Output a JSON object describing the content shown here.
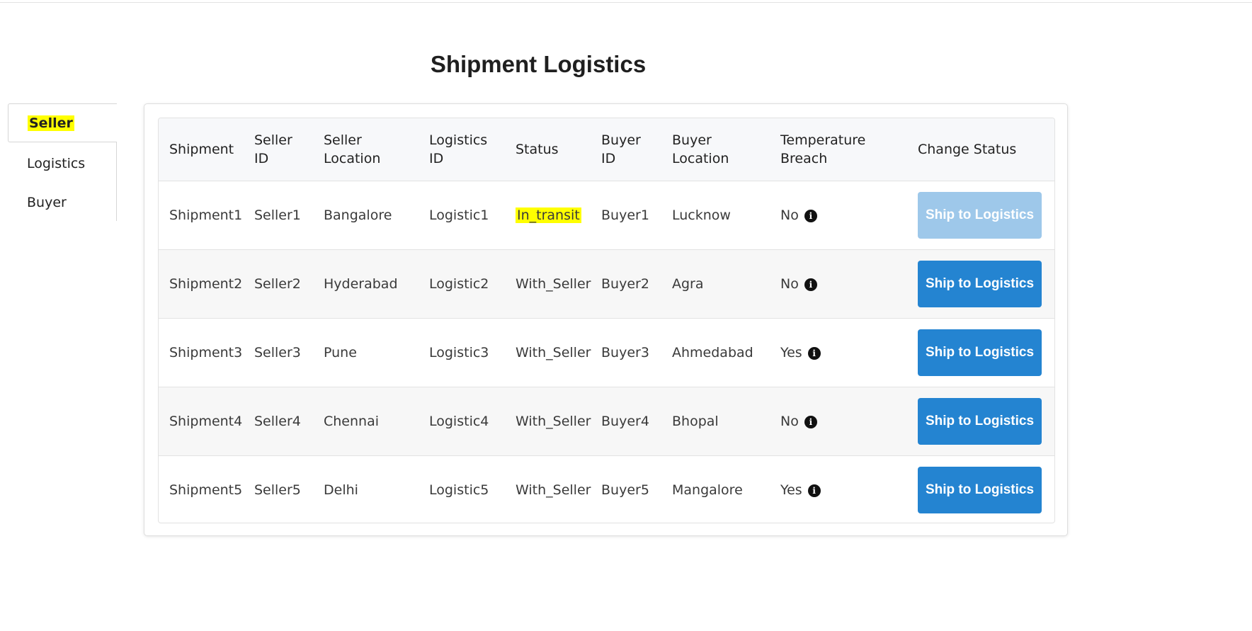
{
  "page": {
    "title": "Shipment Logistics"
  },
  "tabs": [
    {
      "label": "Seller",
      "active": true
    },
    {
      "label": "Logistics",
      "active": false
    },
    {
      "label": "Buyer",
      "active": false
    }
  ],
  "table": {
    "headers": [
      [
        "Shipment"
      ],
      [
        "Seller",
        "ID"
      ],
      [
        "Seller",
        "Location"
      ],
      [
        "Logistics",
        "ID"
      ],
      [
        "Status"
      ],
      [
        "Buyer",
        "ID"
      ],
      [
        "Buyer",
        "Location"
      ],
      [
        "Temperature",
        "Breach"
      ],
      [
        "Change Status"
      ]
    ],
    "rows": [
      {
        "shipment": "Shipment1",
        "seller_id": "Seller1",
        "seller_location": "Bangalore",
        "logistics_id": "Logistic1",
        "status": "In_transit",
        "status_highlighted": true,
        "buyer_id": "Buyer1",
        "buyer_location": "Lucknow",
        "temperature_breach": "No",
        "action": "Ship to Logistics",
        "action_disabled": true
      },
      {
        "shipment": "Shipment2",
        "seller_id": "Seller2",
        "seller_location": "Hyderabad",
        "logistics_id": "Logistic2",
        "status": "With_Seller",
        "status_highlighted": false,
        "buyer_id": "Buyer2",
        "buyer_location": "Agra",
        "temperature_breach": "No",
        "action": "Ship to Logistics",
        "action_disabled": false
      },
      {
        "shipment": "Shipment3",
        "seller_id": "Seller3",
        "seller_location": "Pune",
        "logistics_id": "Logistic3",
        "status": "With_Seller",
        "status_highlighted": false,
        "buyer_id": "Buyer3",
        "buyer_location": "Ahmedabad",
        "temperature_breach": "Yes",
        "action": "Ship to Logistics",
        "action_disabled": false
      },
      {
        "shipment": "Shipment4",
        "seller_id": "Seller4",
        "seller_location": "Chennai",
        "logistics_id": "Logistic4",
        "status": "With_Seller",
        "status_highlighted": false,
        "buyer_id": "Buyer4",
        "buyer_location": "Bhopal",
        "temperature_breach": "No",
        "action": "Ship to Logistics",
        "action_disabled": false
      },
      {
        "shipment": "Shipment5",
        "seller_id": "Seller5",
        "seller_location": "Delhi",
        "logistics_id": "Logistic5",
        "status": "With_Seller",
        "status_highlighted": false,
        "buyer_id": "Buyer5",
        "buyer_location": "Mangalore",
        "temperature_breach": "Yes",
        "action": "Ship to Logistics",
        "action_disabled": false
      }
    ]
  },
  "icons": {
    "temperature_info": "info-circle-icon"
  },
  "colors": {
    "highlight": "#ffff00",
    "button": "#2484d1",
    "button_disabled": "#9ec8ea"
  }
}
